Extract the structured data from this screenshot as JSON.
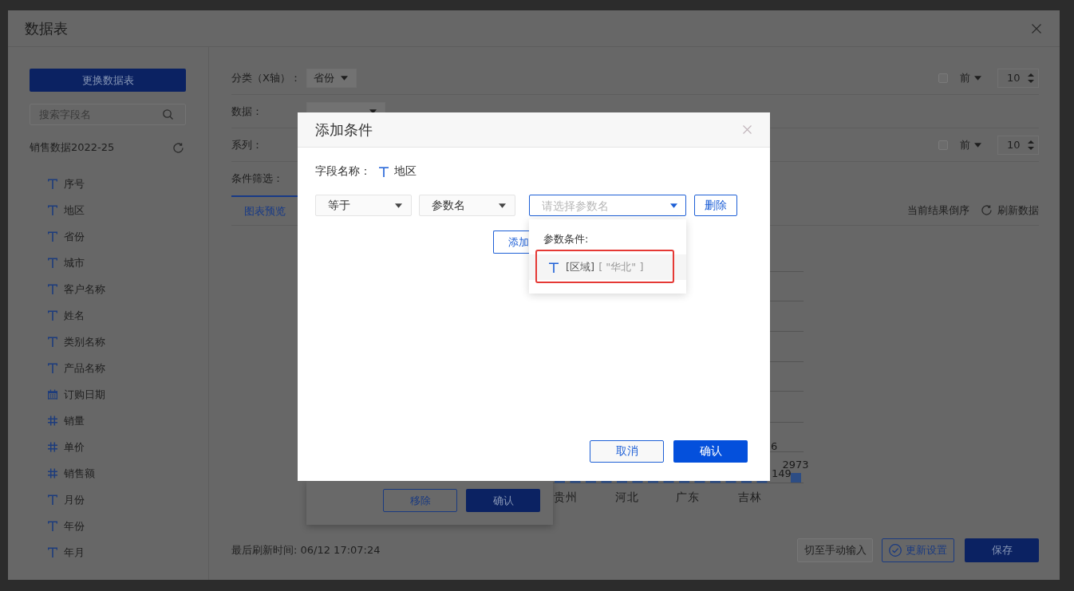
{
  "dialog": {
    "title": "数据表"
  },
  "sidebar": {
    "change_table_button": "更换数据表",
    "search": {
      "placeholder": "搜索字段名"
    },
    "table_name": "销售数据2022-25",
    "fields": [
      {
        "kind": "text",
        "label": "序号"
      },
      {
        "kind": "text",
        "label": "地区"
      },
      {
        "kind": "text",
        "label": "省份"
      },
      {
        "kind": "text",
        "label": "城市"
      },
      {
        "kind": "text",
        "label": "客户名称"
      },
      {
        "kind": "text",
        "label": "姓名"
      },
      {
        "kind": "text",
        "label": "类别名称"
      },
      {
        "kind": "text",
        "label": "产品名称"
      },
      {
        "kind": "date",
        "label": "订购日期"
      },
      {
        "kind": "number",
        "label": "销量"
      },
      {
        "kind": "number",
        "label": "单价"
      },
      {
        "kind": "number",
        "label": "销售额"
      },
      {
        "kind": "text",
        "label": "月份"
      },
      {
        "kind": "text",
        "label": "年份"
      },
      {
        "kind": "text",
        "label": "年月"
      }
    ]
  },
  "settings": [
    {
      "label": "分类（X轴）：",
      "kind": "select",
      "value": "省份",
      "top_n": {
        "checked": false,
        "order": "前",
        "count": "10"
      }
    },
    {
      "label": "数据：",
      "kind": "select"
    },
    {
      "label": "系列：",
      "kind": "plain",
      "top_n": {
        "checked": false,
        "order": "前",
        "count": "10"
      }
    },
    {
      "label": "条件筛选：",
      "kind": "plain"
    }
  ],
  "tabs": [
    {
      "label": "图表预览",
      "selected": true
    }
  ],
  "chart_toolbar": {
    "reverse_order": "当前结果倒序",
    "refresh": "刷新数据"
  },
  "chart": {
    "category_labels": [
      "贵州",
      "河北",
      "广东",
      "吉林"
    ],
    "value_labels": [
      "6",
      "149",
      "2973"
    ]
  },
  "popover": {
    "buttons": [
      {
        "kind": "outline",
        "label": "移除"
      },
      {
        "kind": "primary",
        "label": "确认"
      }
    ]
  },
  "footer": {
    "last_refresh": "最后刷新时间: 06/12 17:07:24",
    "buttons": [
      {
        "kind": "plain",
        "label": "切至手动输入"
      },
      {
        "kind": "outline",
        "label": "更新设置"
      },
      {
        "kind": "primary",
        "label": "保存"
      }
    ]
  },
  "modal": {
    "title": "添加条件",
    "field_label": "字段名称：",
    "field": {
      "kind": "text",
      "name": "地区"
    },
    "condition": {
      "operator": "等于",
      "value_type": "参数名",
      "parameter": {
        "placeholder": "请选择参数名"
      },
      "delete_button": "删除"
    },
    "add_button": "添加",
    "menu": {
      "heading": "参数条件:",
      "items": [
        {
          "kind": "text",
          "name": "[区域]",
          "values": "[ \"华北\" ]",
          "highlighted": true
        }
      ]
    },
    "buttons": [
      {
        "kind": "outline",
        "label": "取消"
      },
      {
        "kind": "primary",
        "label": "确认"
      }
    ]
  }
}
